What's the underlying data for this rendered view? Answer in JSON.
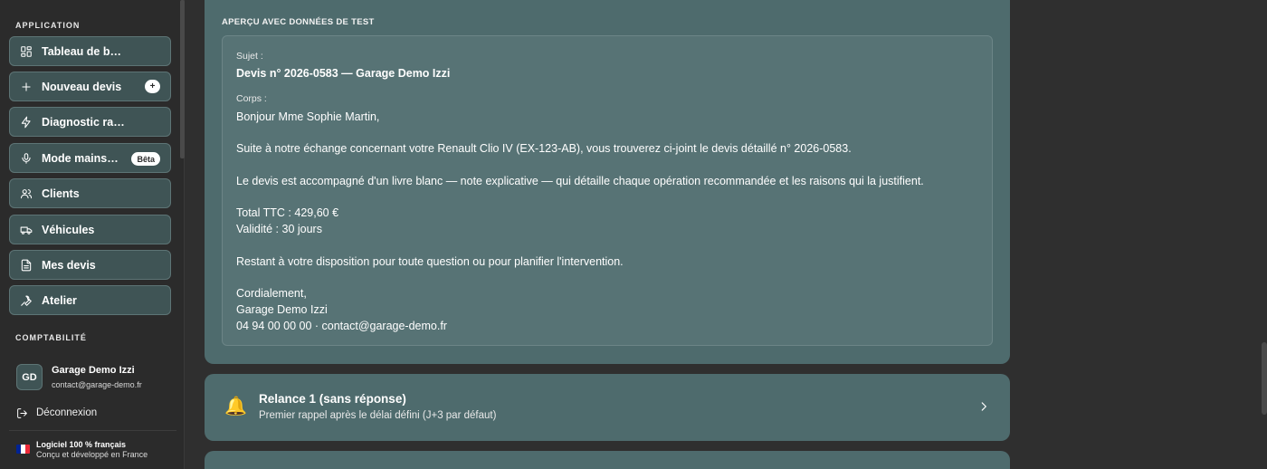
{
  "sidebar": {
    "section_app": "APPLICATION",
    "section_compta": "COMPTABILITÉ",
    "items": [
      {
        "label": "Tableau de bord",
        "icon": "dashboard-icon"
      },
      {
        "label": "Nouveau devis",
        "icon": "plus-icon",
        "badge": "+"
      },
      {
        "label": "Diagnostic rapide",
        "icon": "lightning-icon"
      },
      {
        "label": "Mode mains libres",
        "icon": "microphone-icon",
        "badge": "Bêta"
      },
      {
        "label": "Clients",
        "icon": "users-icon"
      },
      {
        "label": "Véhicules",
        "icon": "truck-icon"
      },
      {
        "label": "Mes devis",
        "icon": "document-icon"
      },
      {
        "label": "Atelier",
        "icon": "wrench-icon"
      }
    ],
    "user": {
      "initials": "GD",
      "name": "Garage Demo Izzi",
      "email": "contact@garage-demo.fr"
    },
    "logout_label": "Déconnexion",
    "made_in": {
      "title": "Logiciel 100 % français",
      "subtitle": "Conçu et développé en France",
      "flag_colors": [
        "#002395",
        "#ffffff",
        "#ed2939"
      ]
    }
  },
  "preview": {
    "title": "APERÇU AVEC DONNÉES DE TEST",
    "subject_label": "Sujet :",
    "subject": "Devis n° 2026-0583 — Garage Demo Izzi",
    "body_label": "Corps :",
    "body_lines": [
      "Bonjour Mme Sophie Martin,",
      "Suite à notre échange concernant votre Renault Clio IV (EX-123-AB), vous trouverez ci-joint le devis détaillé n° 2026-0583.",
      "Le devis est accompagné d'un livre blanc — note explicative — qui détaille chaque opération recommandée et les raisons qui la justifient.",
      "Total TTC : 429,60 €",
      "Validité : 30 jours",
      "Restant à votre disposition pour toute question ou pour planifier l'intervention.",
      "Cordialement,",
      "Garage Demo Izzi",
      "04 94 00 00 00 · contact@garage-demo.fr"
    ]
  },
  "relance": {
    "icon": "bell-icon",
    "title": "Relance 1 (sans réponse)",
    "subtitle": "Premier rappel après le délai défini (J+3 par défaut)"
  },
  "colors": {
    "accent": "#4e6b6d",
    "inner": "#577375",
    "nav_bg": "#3f5455",
    "background": "#2f2f2f"
  }
}
